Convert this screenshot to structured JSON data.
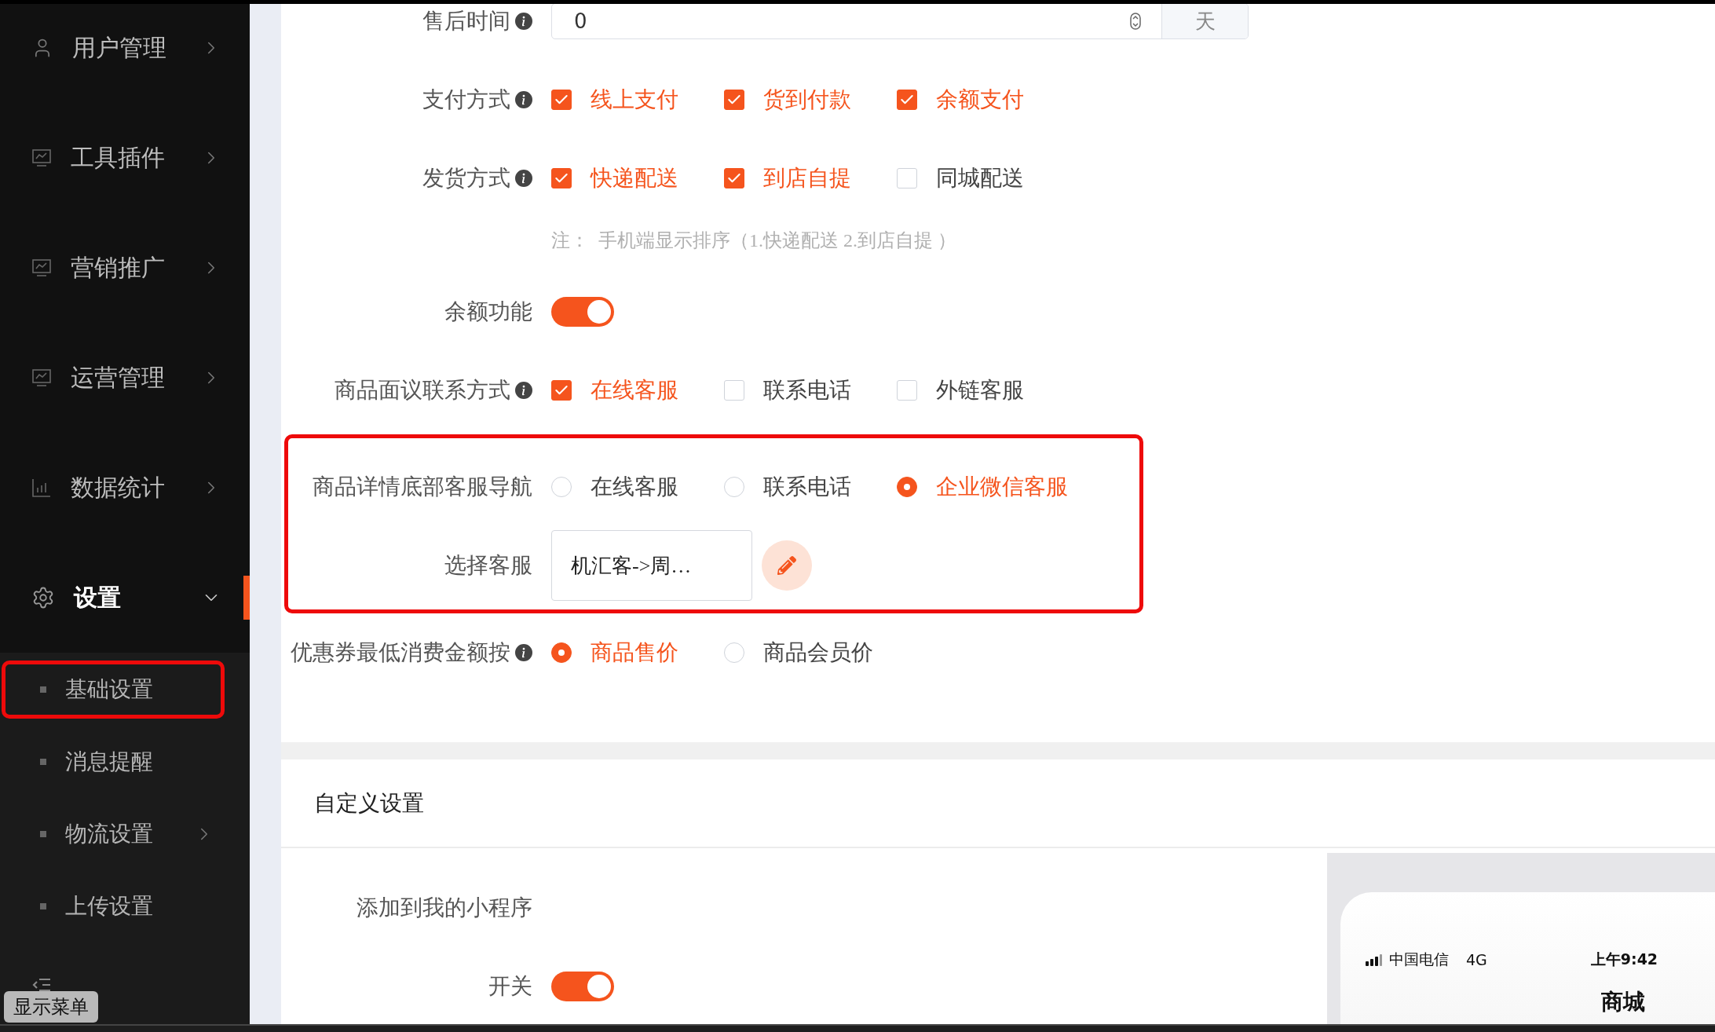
{
  "sidebar": {
    "items": [
      {
        "label": "用户管理",
        "selected": false,
        "expanded": false
      },
      {
        "label": "工具插件",
        "selected": false,
        "expanded": false
      },
      {
        "label": "营销推广",
        "selected": false,
        "expanded": false
      },
      {
        "label": "运营管理",
        "selected": false,
        "expanded": false
      },
      {
        "label": "数据统计",
        "selected": false,
        "expanded": false
      },
      {
        "label": "设置",
        "selected": true,
        "expanded": true,
        "children": [
          {
            "label": "基础设置",
            "highlighted": true,
            "has_children": false
          },
          {
            "label": "消息提醒",
            "highlighted": false,
            "has_children": false
          },
          {
            "label": "物流设置",
            "highlighted": false,
            "has_children": true
          },
          {
            "label": "上传设置",
            "highlighted": false,
            "has_children": false
          }
        ]
      }
    ],
    "menu_toggle": {
      "tooltip": "显示菜单"
    }
  },
  "form": {
    "rows": [
      {
        "kind": "number",
        "label": "售后时间",
        "info": true,
        "value": "0",
        "suffix": "天"
      },
      {
        "kind": "checkboxes",
        "label": "支付方式",
        "info": true,
        "options": [
          {
            "label": "线上支付",
            "checked": true
          },
          {
            "label": "货到付款",
            "checked": true
          },
          {
            "label": "余额支付",
            "checked": true
          }
        ]
      },
      {
        "kind": "checkboxes",
        "label": "发货方式",
        "info": true,
        "options": [
          {
            "label": "快递配送",
            "checked": true
          },
          {
            "label": "到店自提",
            "checked": true
          },
          {
            "label": "同城配送",
            "checked": false
          }
        ],
        "note": "注：  手机端显示排序（1.快递配送 2.到店自提 ）"
      },
      {
        "kind": "switch",
        "label": "余额功能",
        "on": true
      },
      {
        "kind": "checkboxes",
        "label": "商品面议联系方式",
        "info": true,
        "options": [
          {
            "label": "在线客服",
            "checked": true
          },
          {
            "label": "联系电话",
            "checked": false
          },
          {
            "label": "外链客服",
            "checked": false
          }
        ]
      },
      {
        "kind": "group",
        "highlighted": true,
        "rows": [
          {
            "kind": "radios",
            "label": "商品详情底部客服导航",
            "options": [
              {
                "label": "在线客服",
                "selected": false
              },
              {
                "label": "联系电话",
                "selected": false
              },
              {
                "label": "企业微信客服",
                "selected": true
              }
            ]
          },
          {
            "kind": "picker",
            "label": "选择客服",
            "value": "机汇客->周…"
          }
        ]
      },
      {
        "kind": "radios",
        "label": "优惠券最低消费金额按",
        "info": true,
        "options": [
          {
            "label": "商品售价",
            "selected": true
          },
          {
            "label": "商品会员价",
            "selected": false
          }
        ]
      }
    ]
  },
  "custom_section": {
    "title": "自定义设置",
    "rows": [
      {
        "kind": "heading",
        "label": "添加到我的小程序"
      },
      {
        "kind": "switch",
        "label": "开关",
        "on": true
      }
    ],
    "phone_preview": {
      "carrier": "中国电信",
      "network": "4G",
      "time": "上午9:42",
      "title": "商城"
    }
  }
}
